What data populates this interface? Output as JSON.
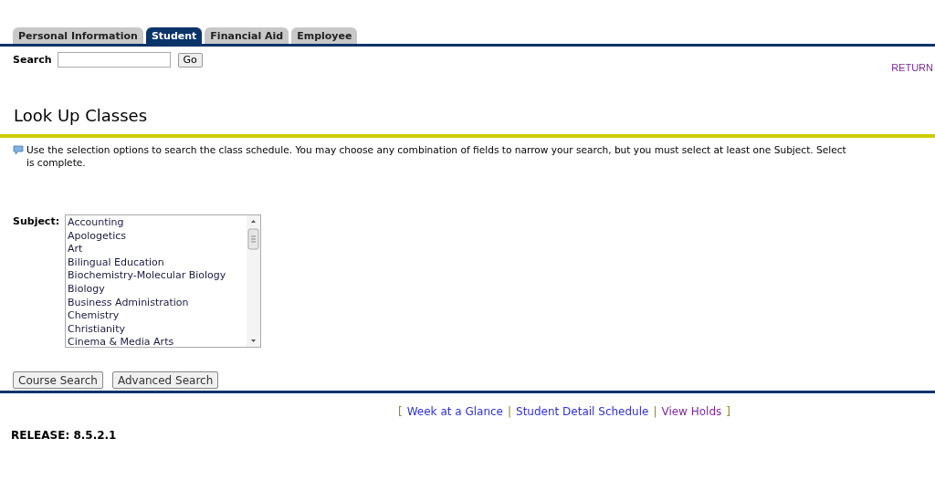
{
  "tabs": [
    {
      "label": "Personal Information",
      "selected": false
    },
    {
      "label": "Student",
      "selected": true
    },
    {
      "label": "Financial Aid",
      "selected": false
    },
    {
      "label": "Employee",
      "selected": false
    }
  ],
  "search": {
    "label": "Search",
    "button": "Go"
  },
  "return_link": {
    "label": "RETURN",
    "visited": true
  },
  "page_title": "Look Up Classes",
  "info": {
    "lines": [
      "Use the selection options to search the class schedule. You may choose any combination of fields to narrow your search, but you must select at least one Subject. Select",
      "is complete."
    ]
  },
  "subject": {
    "label": "Subject:",
    "options": [
      {
        "label": "Accounting",
        "selected": false
      },
      {
        "label": "Apologetics",
        "selected": false
      },
      {
        "label": "Art",
        "selected": false
      },
      {
        "label": "Bilingual Education",
        "selected": false
      },
      {
        "label": "Biochemistry-Molecular Biology",
        "selected": false
      },
      {
        "label": "Biology",
        "selected": false
      },
      {
        "label": "Business Administration",
        "selected": false
      },
      {
        "label": "Chemistry",
        "selected": false
      },
      {
        "label": "Christianity",
        "selected": false
      },
      {
        "label": "Cinema & Media Arts",
        "selected": false
      }
    ]
  },
  "buttons": [
    "Course Search",
    "Advanced Search"
  ],
  "footer_links": {
    "open_bracket": "[",
    "close_bracket": "]",
    "separators": [
      "|",
      "|"
    ],
    "links": [
      {
        "label": "Week at a Glance",
        "visited": false
      },
      {
        "label": "Student Detail Schedule",
        "visited": false
      },
      {
        "label": "View Holds",
        "visited": true
      }
    ]
  },
  "release": "RELEASE: 8.5.2.1"
}
